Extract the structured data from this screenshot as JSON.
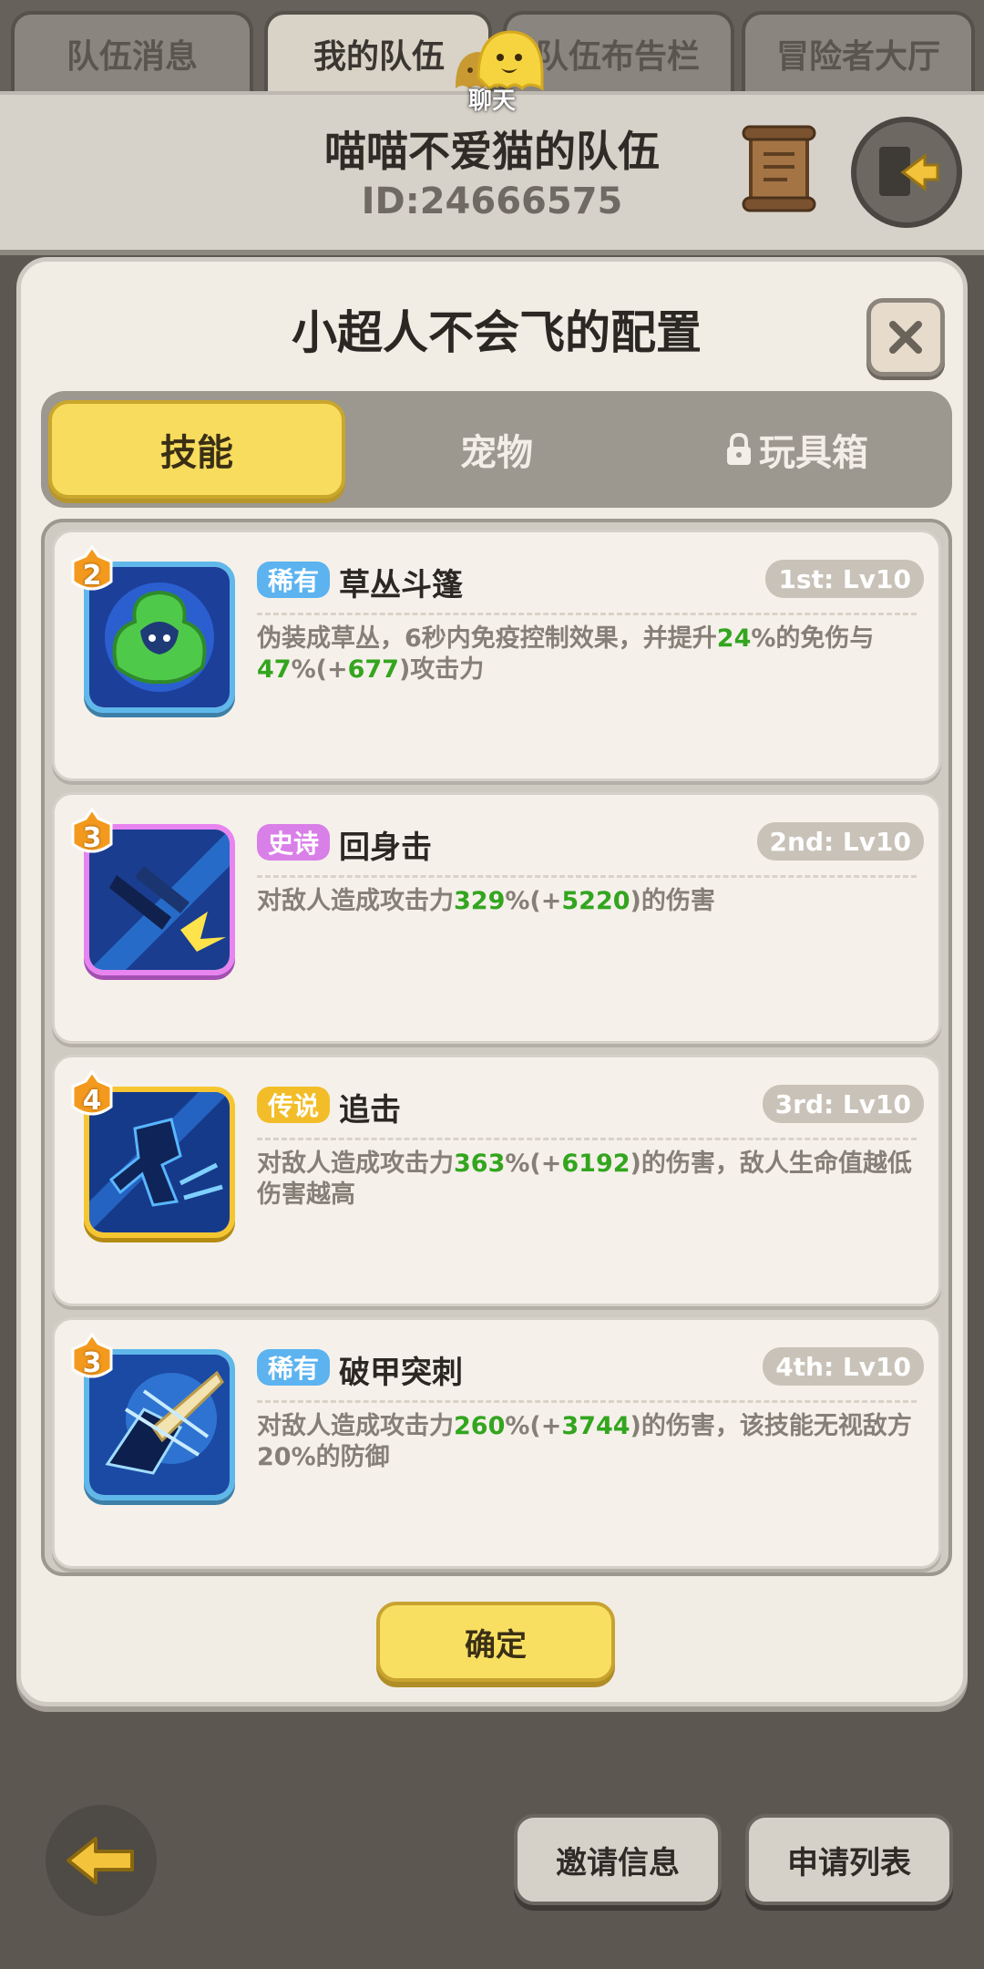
{
  "top_tabs": [
    {
      "label": "队伍消息"
    },
    {
      "label": "我的队伍"
    },
    {
      "label": "队伍布告栏"
    },
    {
      "label": "冒险者大厅"
    }
  ],
  "header": {
    "team_name": "喵喵不爱猫的队伍",
    "team_id": "ID:24666575",
    "chat_label": "聊天"
  },
  "modal": {
    "title": "小超人不会飞的配置",
    "segments": [
      {
        "label": "技能",
        "active": true
      },
      {
        "label": "宠物",
        "active": false
      },
      {
        "label": "玩具箱",
        "active": false,
        "locked": true
      }
    ],
    "skills": [
      {
        "rarity": "稀有",
        "rarity_color": "#5cb3ef",
        "name": "草丛斗篷",
        "level": "2",
        "slot": "1st: Lv10",
        "frame_color": "#60b8ea",
        "desc_parts": [
          "伪装成草丛，6秒内免疫控制效果，并提升",
          "24",
          "%的免伤与",
          "47",
          "%(+",
          "677",
          ")攻击力"
        ]
      },
      {
        "rarity": "史诗",
        "rarity_color": "#d97fe8",
        "name": "回身击",
        "level": "3",
        "slot": "2nd: Lv10",
        "frame_color": "#e784f0",
        "desc_parts": [
          "对敌人造成攻击力",
          "329",
          "%(+",
          "5220",
          ")的伤害"
        ]
      },
      {
        "rarity": "传说",
        "rarity_color": "#f2bd28",
        "name": "追击",
        "level": "4",
        "slot": "3rd: Lv10",
        "frame_color": "#f6c631",
        "desc_parts": [
          "对敌人造成攻击力",
          "363",
          "%(+",
          "6192",
          ")的伤害，敌人生命值越低伤害越高"
        ]
      },
      {
        "rarity": "稀有",
        "rarity_color": "#5cb3ef",
        "name": "破甲突刺",
        "level": "3",
        "slot": "4th: Lv10",
        "frame_color": "#60b8ea",
        "desc_parts": [
          "对敌人造成攻击力",
          "260",
          "%(+",
          "3744",
          ")的伤害，该技能无视敌方20%的防御"
        ]
      }
    ],
    "confirm_label": "确定"
  },
  "bottom": {
    "invite_label": "邀请信息",
    "apply_label": "申请列表"
  },
  "colors": {
    "highlight_green": "#33a51f",
    "confirm_yellow": "#f8df62"
  }
}
